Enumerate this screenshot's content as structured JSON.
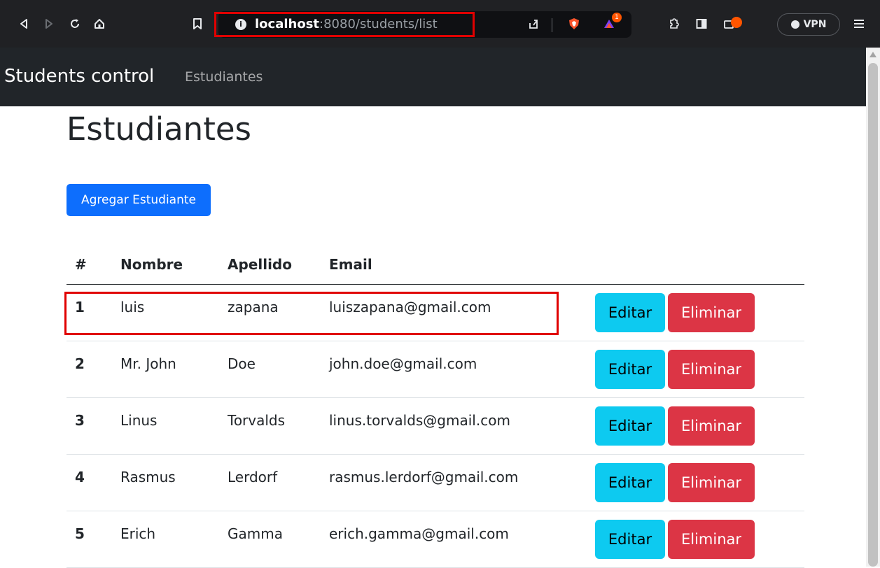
{
  "browser": {
    "url_host": "localhost",
    "url_path": ":8080/students/list",
    "info_icon": "info-icon",
    "notification_count": "1",
    "vpn_label": "VPN",
    "colors": {
      "chrome": "#202124",
      "highlight": "#e00000"
    }
  },
  "navbar": {
    "brand": "Students control",
    "link": "Estudiantes"
  },
  "page": {
    "title": "Estudiantes",
    "add_button": "Agregar Estudiante"
  },
  "table": {
    "headers": [
      "#",
      "Nombre",
      "Apellido",
      "Email"
    ],
    "edit_label": "Editar",
    "delete_label": "Eliminar",
    "rows": [
      {
        "id": "1",
        "nombre": "luis",
        "apellido": "zapana",
        "email": "luiszapana@gmail.com"
      },
      {
        "id": "2",
        "nombre": "Mr. John",
        "apellido": "Doe",
        "email": "john.doe@gmail.com"
      },
      {
        "id": "3",
        "nombre": "Linus",
        "apellido": "Torvalds",
        "email": "linus.torvalds@gmail.com"
      },
      {
        "id": "4",
        "nombre": "Rasmus",
        "apellido": "Lerdorf",
        "email": "rasmus.lerdorf@gmail.com"
      },
      {
        "id": "5",
        "nombre": "Erich",
        "apellido": "Gamma",
        "email": "erich.gamma@gmail.com"
      }
    ],
    "colors": {
      "primary": "#0d6efd",
      "info": "#0dcaf0",
      "danger": "#dc3545"
    }
  }
}
